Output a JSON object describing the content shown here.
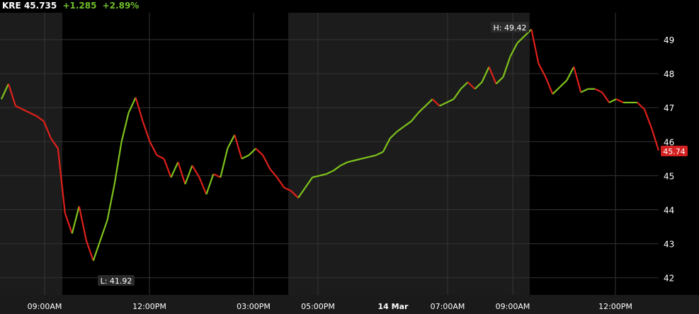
{
  "header": {
    "symbol": "KRE",
    "last": "45.735",
    "change": "+1.285",
    "change_pct": "+2.89%"
  },
  "colors": {
    "up": "#7fc31c",
    "down": "#e0201a",
    "session_shade": "#1c1c1c",
    "grid": "#333333",
    "last_badge": "#d42020"
  },
  "chart_data": {
    "type": "line",
    "title": "KRE",
    "ylim": [
      41.7,
      49.7
    ],
    "yticks": [
      "42",
      "43",
      "44",
      "45",
      "46",
      "47",
      "48",
      "49"
    ],
    "ytick_values": [
      42,
      43,
      44,
      45,
      46,
      47,
      48,
      49
    ],
    "xtick_labels": [
      "09:00AM",
      "12:00PM",
      "03:00PM",
      "05:00PM",
      "14 Mar",
      "07:00AM",
      "09:00AM",
      "12:00PM"
    ],
    "high_label": "H: 49.42",
    "low_label": "L: 41.92",
    "last_label": "45.74",
    "grid": true,
    "values": [
      47.25,
      47.7,
      47.05,
      46.95,
      46.85,
      46.75,
      46.6,
      46.1,
      45.8,
      43.9,
      43.3,
      44.1,
      43.1,
      42.5,
      43.1,
      43.7,
      44.75,
      46.0,
      46.85,
      47.3,
      46.6,
      46.0,
      45.6,
      45.5,
      44.95,
      45.4,
      44.75,
      45.3,
      44.95,
      44.45,
      45.05,
      44.95,
      45.8,
      46.2,
      45.5,
      45.6,
      45.8,
      45.6,
      45.2,
      44.95,
      44.65,
      44.55,
      44.35,
      44.65,
      44.95,
      45.0,
      45.05,
      45.15,
      45.3,
      45.4,
      45.45,
      45.5,
      45.55,
      45.6,
      45.7,
      46.1,
      46.3,
      46.45,
      46.6,
      46.85,
      47.05,
      47.25,
      47.05,
      47.15,
      47.25,
      47.55,
      47.75,
      47.55,
      47.75,
      48.2,
      47.7,
      47.9,
      48.5,
      48.9,
      49.1,
      49.3,
      48.3,
      47.9,
      47.4,
      47.6,
      47.8,
      48.2,
      47.45,
      47.55,
      47.55,
      47.45,
      47.15,
      47.25,
      47.15,
      47.15,
      47.15,
      46.95,
      46.4,
      45.74
    ]
  }
}
